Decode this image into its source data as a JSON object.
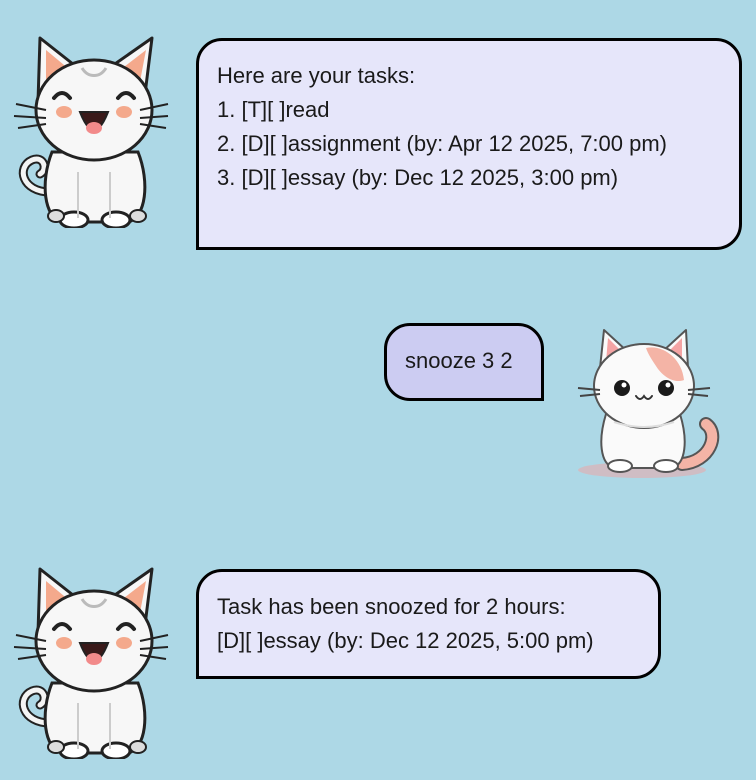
{
  "colors": {
    "background": "#add8e6",
    "bot_bubble": "#e6e6fa",
    "user_bubble": "#ccccf2"
  },
  "messages": [
    {
      "sender": "bot",
      "avatar": "laughing-cat-icon",
      "lines": [
        "Here are your tasks:",
        "1. [T][ ]read",
        "2. [D][ ]assignment (by: Apr 12 2025, 7:00 pm)",
        "3. [D][ ]essay (by: Dec 12 2025, 3:00 pm)"
      ]
    },
    {
      "sender": "user",
      "avatar": "calico-cat-icon",
      "lines": [
        "snooze 3 2"
      ]
    },
    {
      "sender": "bot",
      "avatar": "laughing-cat-icon",
      "lines": [
        "Task has been snoozed for 2 hours:",
        "[D][ ]essay (by: Dec 12 2025, 5:00 pm)"
      ]
    }
  ]
}
